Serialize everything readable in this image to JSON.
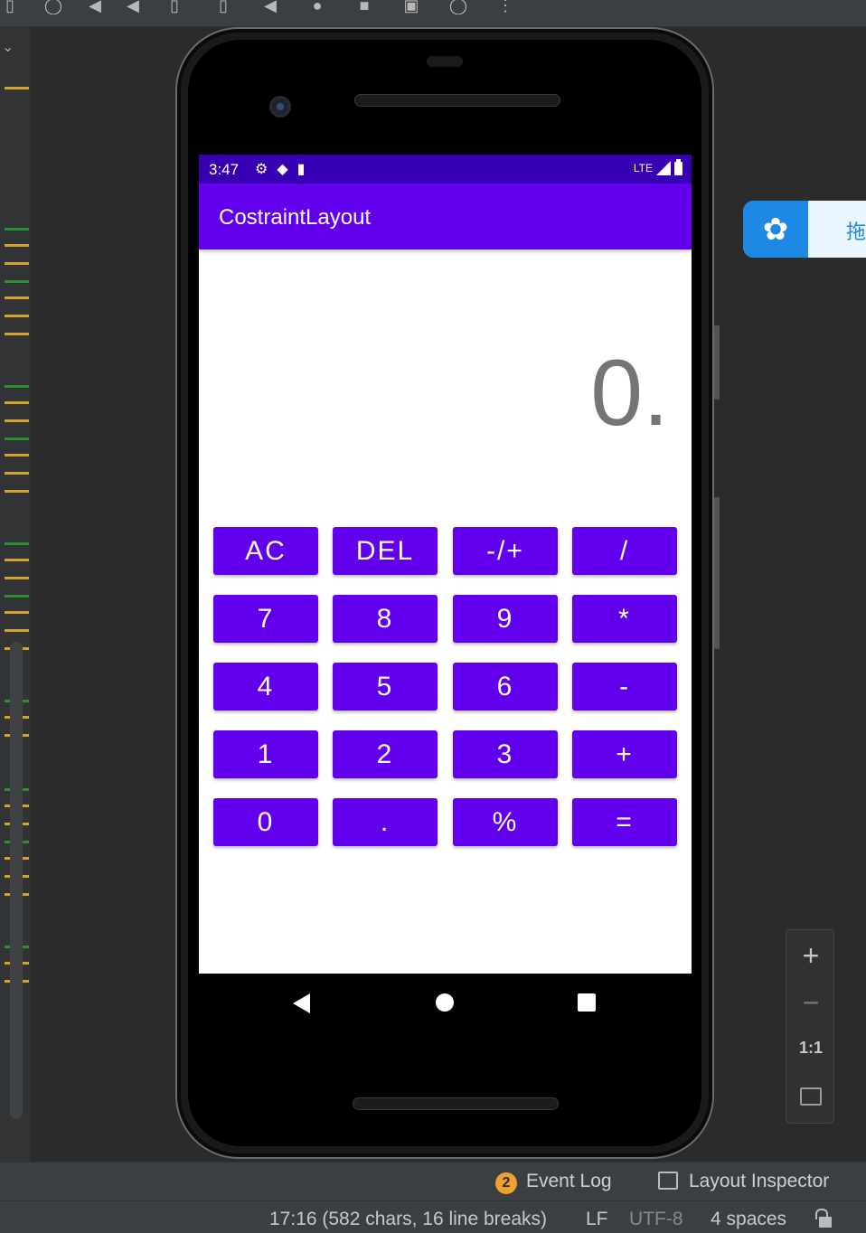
{
  "toolbar": {
    "icons": [
      "device-icon",
      "refresh-icon",
      "volume-up-icon",
      "volume-down-icon",
      "rotate-left-icon",
      "rotate-right-icon",
      "back-icon",
      "record-icon",
      "stop-icon",
      "camera-icon",
      "timer-icon",
      "more-icon"
    ]
  },
  "app": {
    "title": "CostraintLayout",
    "display_value": "0.",
    "status": {
      "time": "3:47",
      "network": "LTE"
    },
    "keypad": [
      [
        "AC",
        "DEL",
        "-/+",
        "/"
      ],
      [
        "7",
        "8",
        "9",
        "*"
      ],
      [
        "4",
        "5",
        "6",
        "-"
      ],
      [
        "1",
        "2",
        "3",
        "+"
      ],
      [
        "0",
        ".",
        "%",
        "="
      ]
    ],
    "colors": {
      "primary": "#6200ee",
      "primary_dark": "#3700b3",
      "display_text": "#757575"
    }
  },
  "float_panel": {
    "text": "拖"
  },
  "zoom": {
    "plus": "+",
    "minus": "−",
    "actual_size": "1:1"
  },
  "tool_tabs": {
    "event_log_count": "2",
    "event_log_label": "Event Log",
    "layout_inspector_label": "Layout Inspector"
  },
  "statusline": {
    "position": "17:16 (582 chars, 16 line breaks)",
    "line_separator": "LF",
    "encoding": "UTF-8",
    "indent": "4 spaces"
  }
}
